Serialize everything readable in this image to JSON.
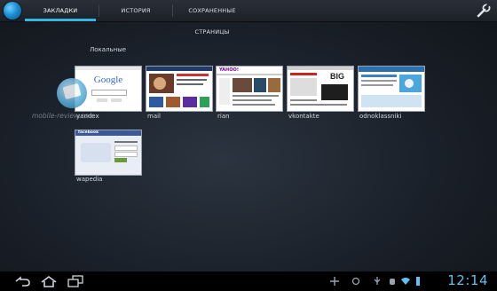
{
  "tabs": [
    {
      "label": "ЗАКЛАДКИ",
      "active": true
    },
    {
      "label": "ИСТОРИЯ",
      "active": false
    },
    {
      "label": "СОХРАНЕННЫЕ СТРАНИЦЫ",
      "active": false
    }
  ],
  "section_label": "Локальные",
  "bookmarks": [
    {
      "label": "yandex",
      "thumb_text": "Google"
    },
    {
      "label": "mail",
      "thumb_text": ""
    },
    {
      "label": "rian",
      "thumb_text": "YAHOO!"
    },
    {
      "label": "vkontakte",
      "thumb_text": "BIG"
    },
    {
      "label": "odnoklassniki",
      "thumb_text": ""
    },
    {
      "label": "wapedia",
      "thumb_text": "facebook"
    }
  ],
  "watermark": "mobile-review.com",
  "clock": "12:14",
  "colors": {
    "accent": "#33b5e5",
    "clock": "#5ec3f2"
  }
}
